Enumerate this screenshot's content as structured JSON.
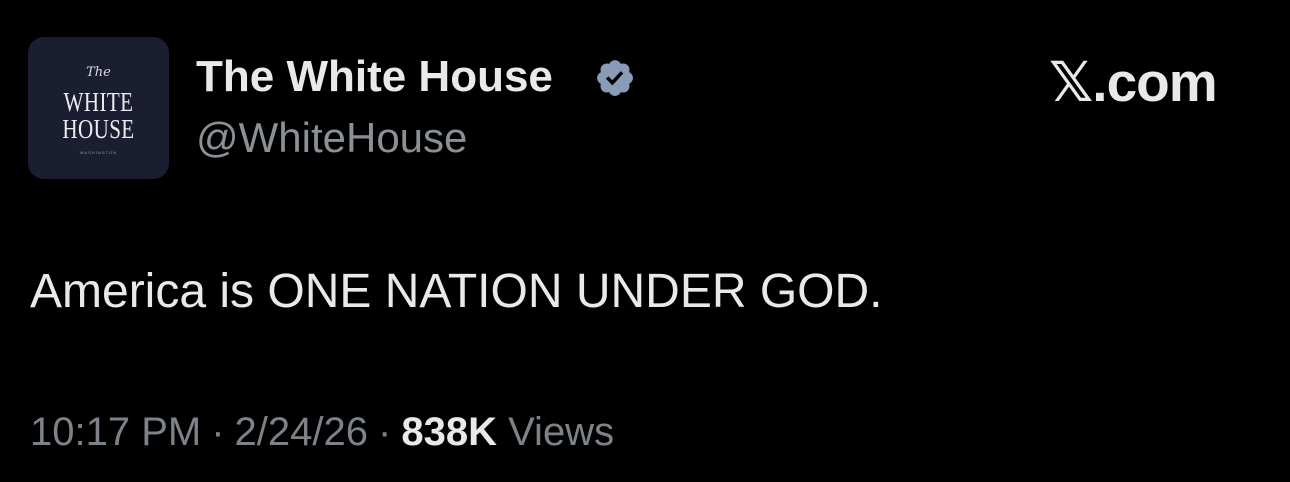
{
  "author": {
    "avatar": {
      "the": "The",
      "line1": "WHITE",
      "line2": "HOUSE",
      "sub": "WASHINGTON"
    },
    "display_name": "The White House",
    "handle": "@WhiteHouse",
    "verified_icon": "verified-badge-icon",
    "verified_color": "#8a9bb8"
  },
  "brand": {
    "x_logo": "𝕏.com"
  },
  "tweet": {
    "text": "America is ONE NATION UNDER GOD."
  },
  "meta": {
    "time": "10:17 PM",
    "separator": "·",
    "date": "2/24/26",
    "views_count": "838K",
    "views_label": "Views"
  },
  "colors": {
    "background": "#000000",
    "primary_text": "#e7e9ea",
    "secondary_text": "#8b9096",
    "avatar_bg": "#1a1e30"
  }
}
